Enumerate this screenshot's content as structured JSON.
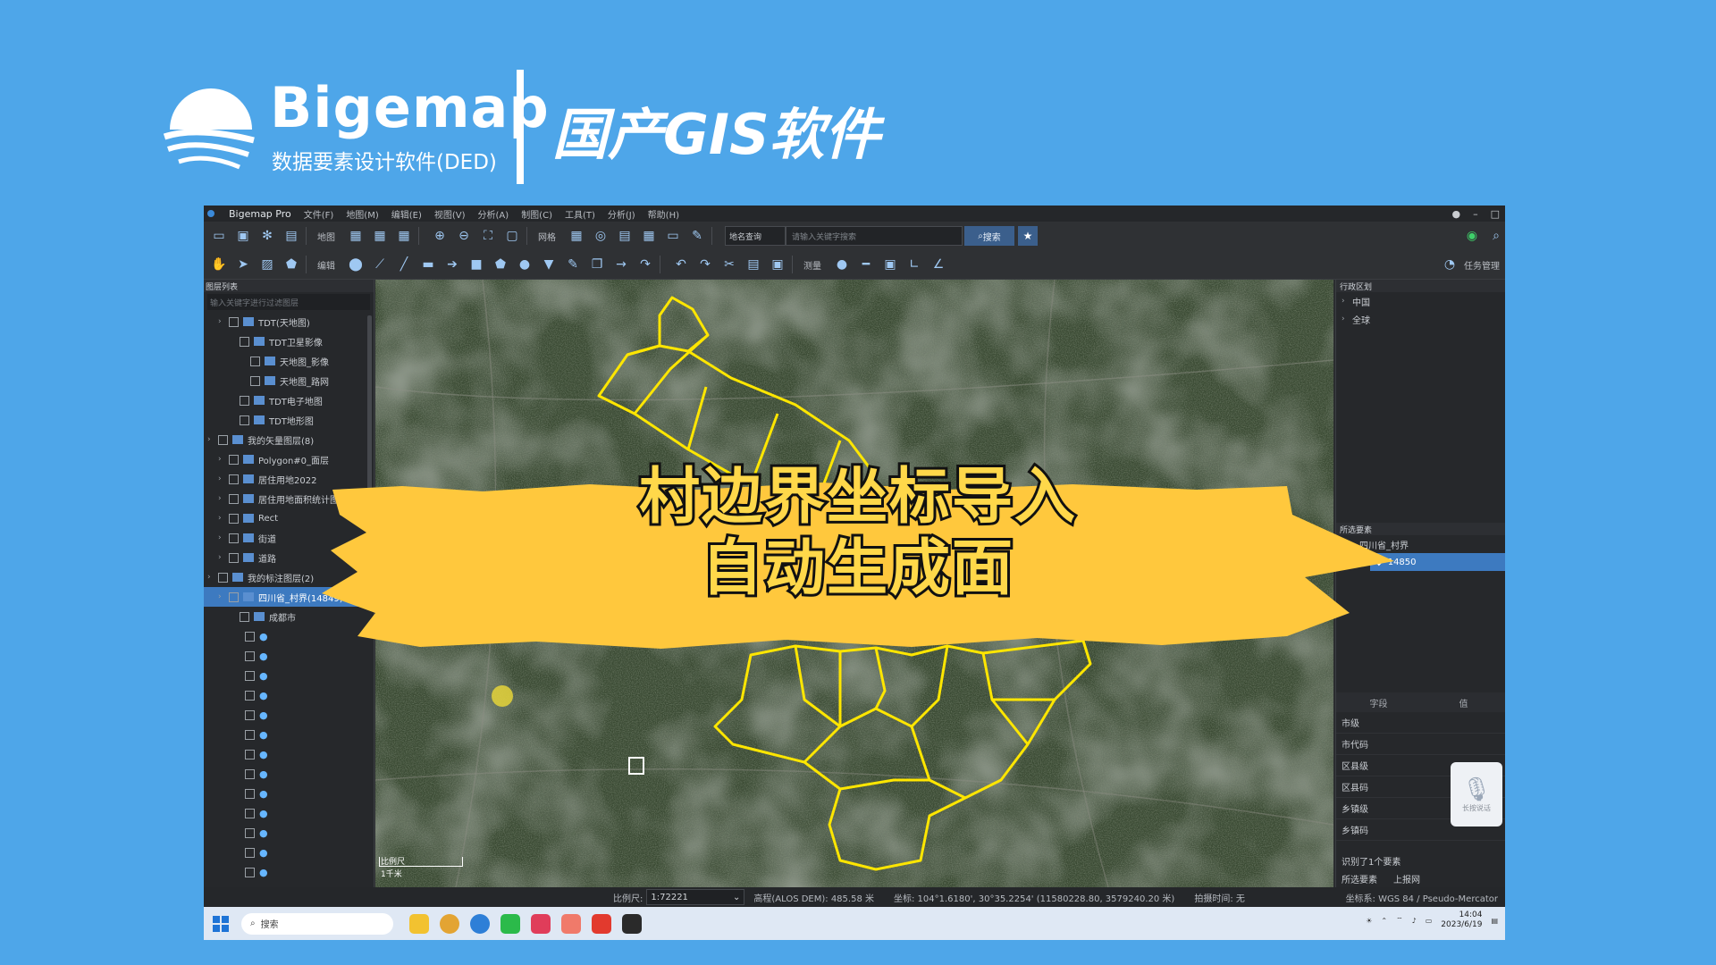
{
  "brand": {
    "name": "Bigemap",
    "subtitle": "数据要素设计软件(DED)",
    "tagline": "国产GIS软件"
  },
  "overlay": {
    "line1": "村边界坐标导入",
    "line2": "自动生成面"
  },
  "app": {
    "title": "Bigemap Pro",
    "menus": [
      "文件(F)",
      "地图(M)",
      "编辑(E)",
      "视图(V)",
      "分析(A)",
      "制图(C)",
      "工具(T)",
      "分析(J)",
      "帮助(H)"
    ],
    "toolbar": {
      "layer_label": "地图",
      "grid_label": "网格",
      "search_mode": "地名查询",
      "search_placeholder": "请输入关键字搜索",
      "search_button": "搜索",
      "edit_label": "编辑",
      "measure_label": "测量",
      "task_label": "任务管理"
    },
    "left_panel": {
      "title": "图层列表",
      "filter_placeholder": "输入关键字进行过滤图层",
      "rows": [
        {
          "label": "TDT(天地图)",
          "level": 1
        },
        {
          "label": "TDT卫星影像",
          "level": 2
        },
        {
          "label": "天地图_影像",
          "level": 3
        },
        {
          "label": "天地图_路网",
          "level": 3
        },
        {
          "label": "TDT电子地图",
          "level": 2
        },
        {
          "label": "TDT地形图",
          "level": 2
        },
        {
          "label": "我的矢量图层(8)",
          "level": 0
        },
        {
          "label": "Polygon#0_面层",
          "level": 1
        },
        {
          "label": "居住用地2022",
          "level": 1
        },
        {
          "label": "居住用地面积统计图",
          "level": 1
        },
        {
          "label": "Rect",
          "level": 1
        },
        {
          "label": "街道",
          "level": 1
        },
        {
          "label": "道路",
          "level": 1
        },
        {
          "label": "我的标注图层(2)",
          "level": 0
        },
        {
          "label": "四川省_村界(14849)",
          "level": 1,
          "selected": true
        },
        {
          "label": "成都市",
          "level": 2
        }
      ],
      "pin_rows": 14
    },
    "right_panel": {
      "region_title": "行政区划",
      "regions": [
        "中国",
        "全球"
      ],
      "selection_title": "所选要素",
      "selection_parent": "四川省_村界",
      "selection_id": "14850",
      "attr_columns": [
        "字段",
        "值"
      ],
      "attrs": [
        "市级",
        "市代码",
        "区县级",
        "区县码",
        "乡镇级",
        "乡镇码"
      ],
      "footer_status": "识别了1个要素",
      "footer_tabs": [
        "所选要素",
        "上报网"
      ],
      "mic_label": "长按说话"
    },
    "status": {
      "scale_label": "比例尺:",
      "scale_value": "1:72221",
      "elevation": "高程(ALOS DEM): 485.58 米",
      "coords": "坐标: 104°1.6180', 30°35.2254'  (11580228.80, 3579240.20 米)",
      "capture": "拍摄时间: 无",
      "crs": "坐标系: WGS 84 / Pseudo-Mercator"
    },
    "scalebar": {
      "label": "比例尺",
      "value": "1千米"
    },
    "taskbar": {
      "search": "搜索",
      "clock_time": "14:04",
      "clock_date": "2023/6/19"
    }
  },
  "colors": {
    "background": "#4ea6e9",
    "banner": "#ffc83d",
    "boundary": "#ffe600",
    "selection": "#3d7ac0"
  }
}
